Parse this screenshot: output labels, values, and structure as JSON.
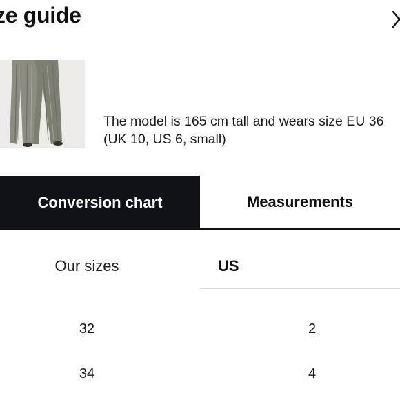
{
  "header": {
    "title": "ze guide",
    "close_icon": "close-icon"
  },
  "model": {
    "line1": "The model is 165 cm tall and wears size EU 36",
    "line2": "(UK 10, US 6, small)"
  },
  "tabs": [
    {
      "label": "Conversion chart",
      "active": true
    },
    {
      "label": "Measurements",
      "active": false
    }
  ],
  "table": {
    "columns": [
      "Our sizes",
      "US"
    ],
    "rows": [
      {
        "ours": "32",
        "us": "2"
      },
      {
        "ours": "34",
        "us": "4"
      }
    ]
  },
  "colors": {
    "active_tab_bg": "#0f1216",
    "active_tab_text": "#ffffff",
    "divider": "#d9d9d9"
  }
}
